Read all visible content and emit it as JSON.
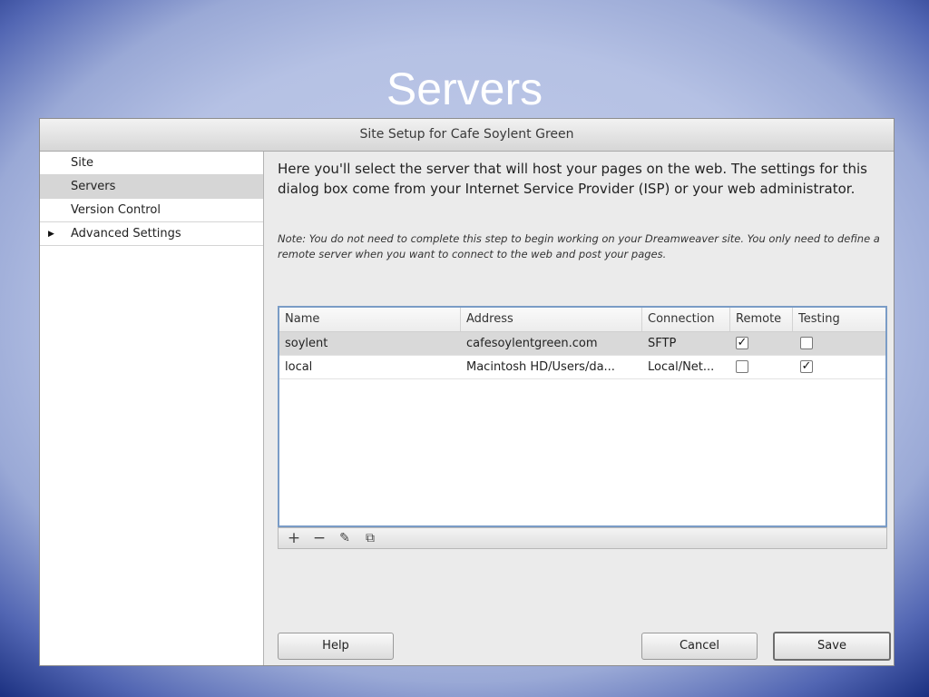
{
  "slide": {
    "title": "Servers"
  },
  "window": {
    "title": "Site Setup for Cafe Soylent Green"
  },
  "sidebar": {
    "items": [
      {
        "label": "Site"
      },
      {
        "label": "Servers"
      },
      {
        "label": "Version Control"
      },
      {
        "label": "Advanced Settings",
        "expand_icon": "disclosure-triangle-icon"
      }
    ],
    "selected": "Servers"
  },
  "content": {
    "description": "Here you'll select the server that will host your pages on the web. The settings for this dialog box come from your Internet Service Provider (ISP) or your web administrator.",
    "note": "Note: You do not need to complete this step to begin working on your Dreamweaver site. You only need to define a remote server when you want to connect to the web and post your pages."
  },
  "servers_table": {
    "columns": [
      "Name",
      "Address",
      "Connection",
      "Remote",
      "Testing"
    ],
    "rows": [
      {
        "name": "soylent",
        "address": "cafesoylentgreen.com",
        "connection": "SFTP",
        "remote": true,
        "testing": false,
        "selected": true
      },
      {
        "name": "local",
        "address": "Macintosh HD/Users/da...",
        "connection": "Local/Net...",
        "remote": false,
        "testing": true,
        "selected": false
      }
    ]
  },
  "table_toolbar": {
    "buttons": [
      {
        "icon": "plus-icon",
        "glyph": "+"
      },
      {
        "icon": "minus-icon",
        "glyph": "−"
      },
      {
        "icon": "pencil-edit-icon",
        "glyph": "✎"
      },
      {
        "icon": "duplicate-icon",
        "glyph": "⧉"
      }
    ]
  },
  "buttons": {
    "help": "Help",
    "cancel": "Cancel",
    "save": "Save"
  },
  "colors": {
    "table_border": "#7a9cc6",
    "selected_row": "#d9d9d9",
    "slide_title": "#ffffff"
  }
}
